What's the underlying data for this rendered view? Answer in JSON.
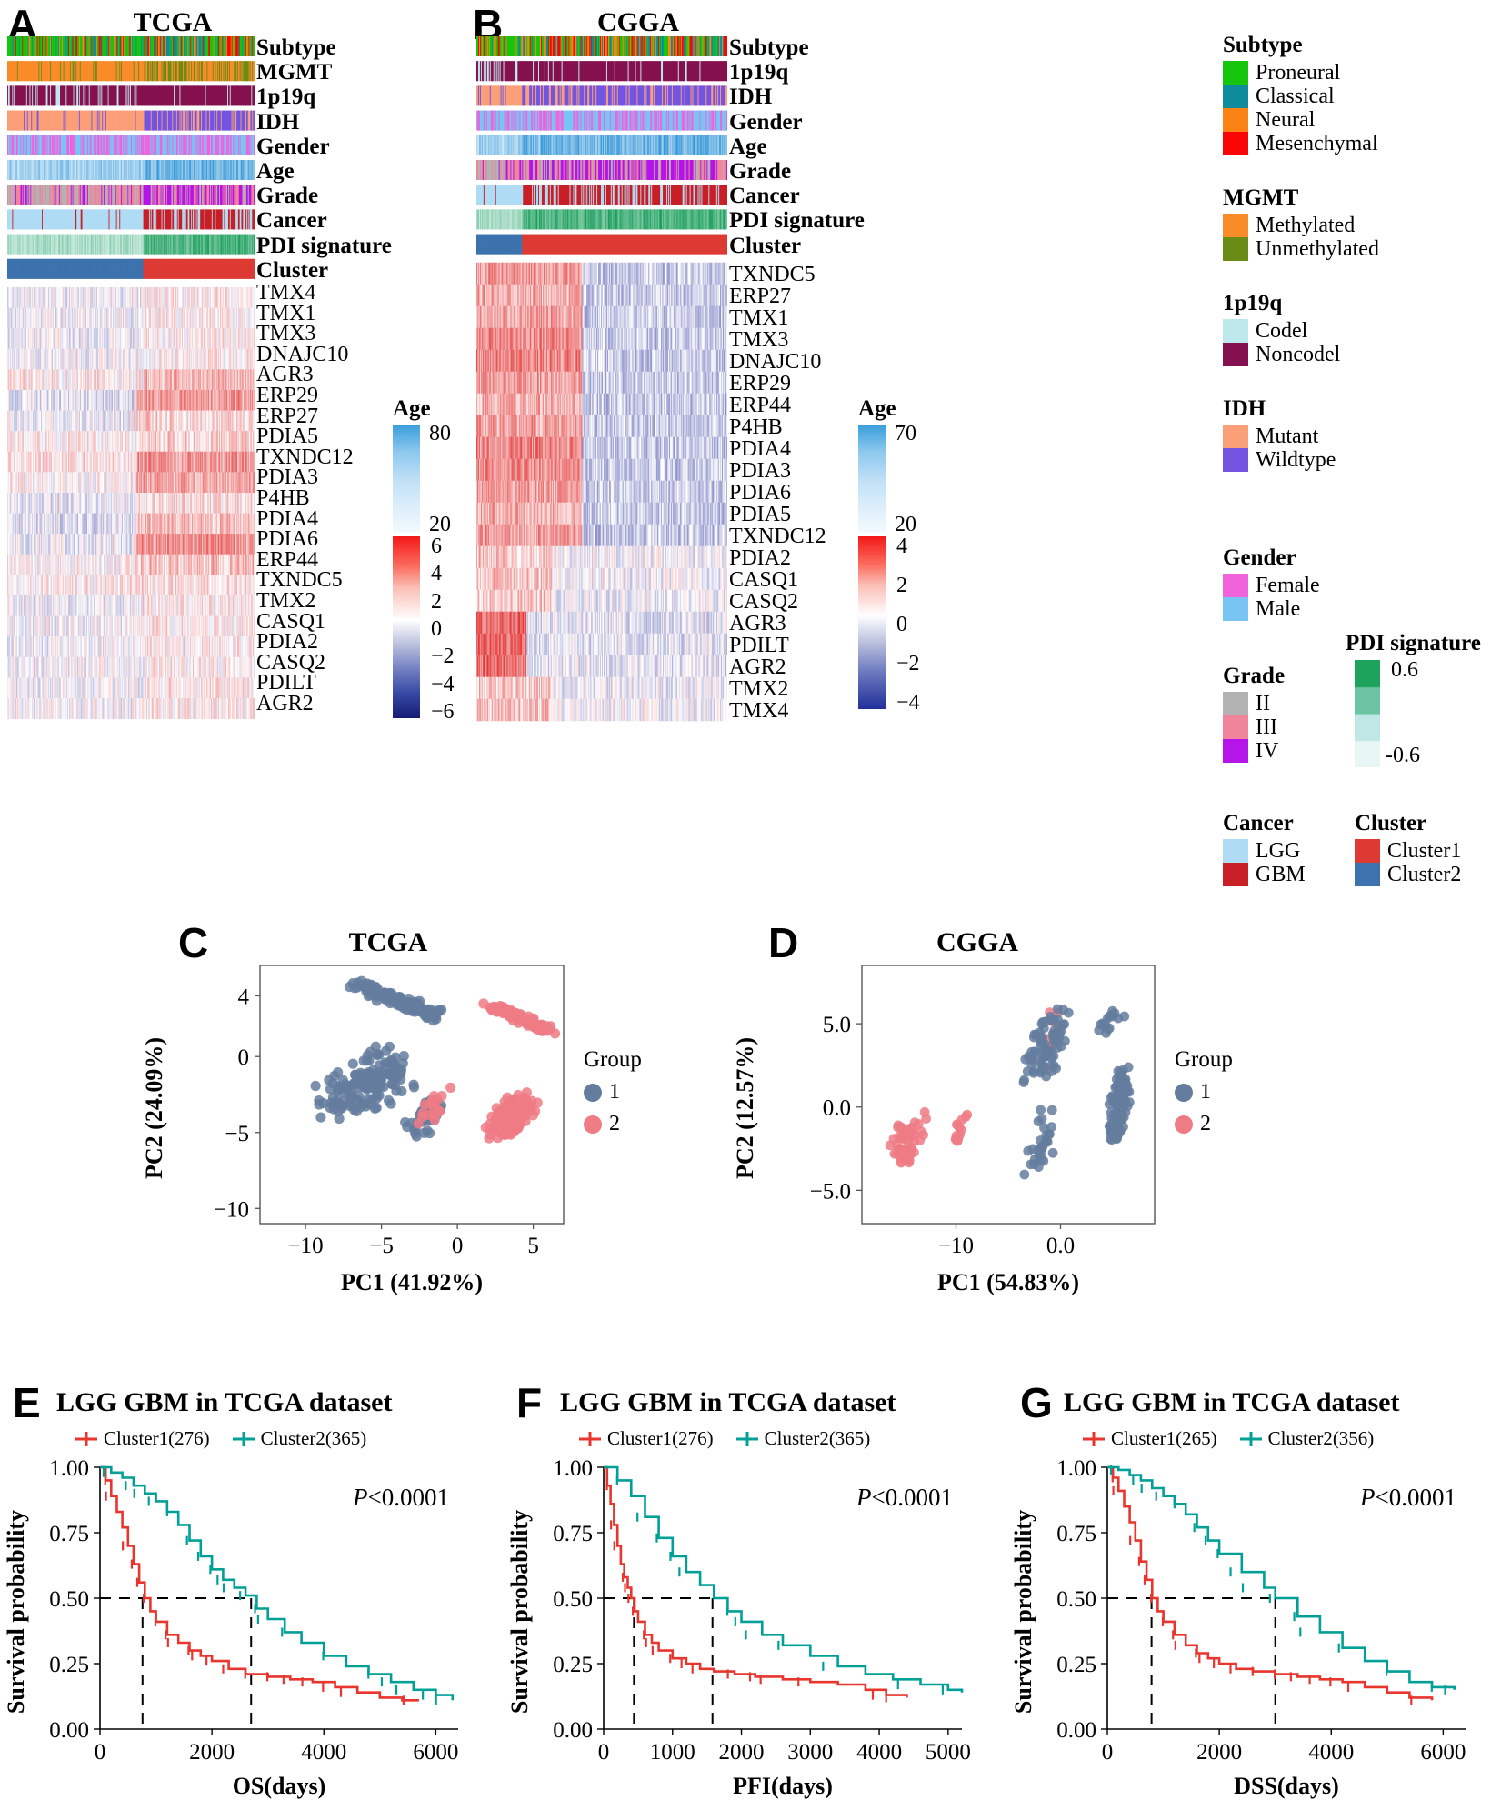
{
  "panels": {
    "A": {
      "letter": "A",
      "title": "TCGA"
    },
    "B": {
      "letter": "B",
      "title": "CGGA"
    },
    "C": {
      "letter": "C",
      "title": "TCGA"
    },
    "D": {
      "letter": "D",
      "title": "CGGA"
    },
    "E": {
      "letter": "E",
      "title": "LGG GBM in TCGA dataset"
    },
    "F": {
      "letter": "F",
      "title": "LGG GBM in TCGA dataset"
    },
    "G": {
      "letter": "G",
      "title": "LGG GBM in TCGA dataset"
    }
  },
  "heatmap_tcga": {
    "annotations": [
      "Subtype",
      "MGMT",
      "1p19q",
      "IDH",
      "Gender",
      "Age",
      "Grade",
      "Cancer",
      "PDI signature",
      "Cluster"
    ],
    "genes": [
      "TMX4",
      "TMX1",
      "TMX3",
      "DNAJC10",
      "AGR3",
      "ERP29",
      "ERP27",
      "PDIA5",
      "TXNDC12",
      "PDIA3",
      "P4HB",
      "PDIA4",
      "PDIA6",
      "ERP44",
      "TXNDC5",
      "TMX2",
      "CASQ1",
      "PDIA2",
      "CASQ2",
      "PDILT",
      "AGR2"
    ],
    "age_legend": {
      "title": "Age",
      "max": "80",
      "min": "20"
    },
    "expr_legend": {
      "ticks": [
        "6",
        "4",
        "2",
        "0",
        "-2",
        "-4",
        "-6"
      ]
    }
  },
  "heatmap_cgga": {
    "annotations": [
      "Subtype",
      "1p19q",
      "IDH",
      "Gender",
      "Age",
      "Grade",
      "Cancer",
      "PDI signature",
      "Cluster"
    ],
    "genes": [
      "TXNDC5",
      "ERP27",
      "TMX1",
      "TMX3",
      "DNAJC10",
      "ERP29",
      "ERP44",
      "P4HB",
      "PDIA4",
      "PDIA3",
      "PDIA6",
      "PDIA5",
      "TXNDC12",
      "PDIA2",
      "CASQ1",
      "CASQ2",
      "AGR3",
      "PDILT",
      "AGR2",
      "TMX2",
      "TMX4"
    ],
    "age_legend": {
      "title": "Age",
      "max": "70",
      "min": "20"
    },
    "expr_legend": {
      "ticks": [
        "4",
        "2",
        "0",
        "-2",
        "-4"
      ]
    }
  },
  "legend": {
    "subtype": {
      "title": "Subtype",
      "items": [
        {
          "label": "Proneural",
          "color": "#16C60C"
        },
        {
          "label": "Classical",
          "color": "#0E8C9B"
        },
        {
          "label": "Neural",
          "color": "#FB8315"
        },
        {
          "label": "Mesenchymal",
          "color": "#FB0606"
        }
      ]
    },
    "mgmt": {
      "title": "MGMT",
      "items": [
        {
          "label": "Methylated",
          "color": "#F98C28"
        },
        {
          "label": "Unmethylated",
          "color": "#6B8B17"
        }
      ]
    },
    "p1p19q": {
      "title": "1p19q",
      "items": [
        {
          "label": "Codel",
          "color": "#BEE9EC"
        },
        {
          "label": "Noncodel",
          "color": "#85104F"
        }
      ]
    },
    "idh": {
      "title": "IDH",
      "items": [
        {
          "label": "Mutant",
          "color": "#FB9F78"
        },
        {
          "label": "Wildtype",
          "color": "#7355E2"
        }
      ]
    },
    "gender": {
      "title": "Gender",
      "items": [
        {
          "label": "Female",
          "color": "#F163DC"
        },
        {
          "label": "Male",
          "color": "#78C5F3"
        }
      ]
    },
    "grade": {
      "title": "Grade",
      "items": [
        {
          "label": "II",
          "color": "#B3B3B3"
        },
        {
          "label": "III",
          "color": "#F0849A"
        },
        {
          "label": "IV",
          "color": "#B515E8"
        }
      ]
    },
    "cancer": {
      "title": "Cancer",
      "items": [
        {
          "label": "LGG",
          "color": "#AFDCF4"
        },
        {
          "label": "GBM",
          "color": "#C91F27"
        }
      ]
    },
    "pdi": {
      "title": "PDI signature",
      "max": "0.6",
      "min": "-0.6"
    },
    "cluster": {
      "title": "Cluster",
      "items": [
        {
          "label": "Cluster1",
          "color": "#DC3A32"
        },
        {
          "label": "Cluster2",
          "color": "#3C72AD"
        }
      ]
    }
  },
  "pca": {
    "group_title": "Group",
    "groups": [
      {
        "label": "1",
        "color": "#647D9E"
      },
      {
        "label": "2",
        "color": "#EF7B85"
      }
    ],
    "tcga": {
      "xlabel": "PC1 (41.92%)",
      "ylabel": "PC2 (24.09%)",
      "xticks": [
        "-10",
        "-5",
        "0",
        "5"
      ],
      "yticks": [
        "-10",
        "-5",
        "0",
        "4"
      ]
    },
    "cgga": {
      "xlabel": "PC1 (54.83%)",
      "ylabel": "PC2 (12.57%)",
      "xticks": [
        "-10",
        "0.0"
      ],
      "yticks": [
        "-5.0",
        "0.0",
        "5.0"
      ]
    }
  },
  "chart_data": [
    {
      "type": "scatter",
      "title": "TCGA",
      "xlabel": "PC1 (41.92%)",
      "ylabel": "PC2 (24.09%)",
      "xlim": [
        -13,
        7
      ],
      "ylim": [
        -11,
        6
      ],
      "xticks": [
        -10,
        -5,
        0,
        5
      ],
      "yticks": [
        -10,
        -5,
        0,
        4
      ],
      "legend": "Group",
      "legend_position": "right",
      "series": [
        {
          "name": "1",
          "color": "#647D9E",
          "n": 365
        },
        {
          "name": "2",
          "color": "#EF7B85",
          "n": 276
        }
      ]
    },
    {
      "type": "scatter",
      "title": "CGGA",
      "xlabel": "PC1 (54.83%)",
      "ylabel": "PC2 (12.57%)",
      "xlim": [
        -19,
        9
      ],
      "ylim": [
        -7,
        8.5
      ],
      "xticks": [
        -10,
        0
      ],
      "yticks": [
        -5,
        0,
        5
      ],
      "legend": "Group",
      "legend_position": "right",
      "series": [
        {
          "name": "1",
          "color": "#647D9E"
        },
        {
          "name": "2",
          "color": "#EF7B85"
        }
      ]
    },
    {
      "type": "line",
      "title": "LGG GBM in TCGA dataset",
      "xlabel": "OS(days)",
      "ylabel": "Survival probability",
      "xlim": [
        0,
        6400
      ],
      "ylim": [
        0,
        1
      ],
      "xticks": [
        0,
        2000,
        4000,
        6000
      ],
      "yticks": [
        0.0,
        0.25,
        0.5,
        0.75,
        1.0
      ],
      "annotation": "P<0.0001",
      "median_lines": [
        760,
        2700
      ],
      "series": [
        {
          "name": "Cluster1(276)",
          "color": "#E8352E",
          "x": [
            0,
            100,
            200,
            300,
            400,
            500,
            600,
            700,
            800,
            900,
            1000,
            1200,
            1400,
            1600,
            1800,
            2000,
            2300,
            2600,
            3000,
            3400,
            3800,
            4200,
            4600,
            5000,
            5400,
            5700
          ],
          "y": [
            1.0,
            0.95,
            0.89,
            0.83,
            0.77,
            0.7,
            0.63,
            0.56,
            0.5,
            0.45,
            0.41,
            0.36,
            0.33,
            0.3,
            0.28,
            0.26,
            0.23,
            0.21,
            0.2,
            0.19,
            0.18,
            0.16,
            0.14,
            0.12,
            0.11,
            0.11
          ]
        },
        {
          "name": "Cluster2(365)",
          "color": "#00A097",
          "x": [
            0,
            200,
            400,
            600,
            800,
            1000,
            1200,
            1400,
            1600,
            1800,
            2000,
            2200,
            2400,
            2600,
            2800,
            3000,
            3300,
            3600,
            4000,
            4400,
            4800,
            5200,
            5600,
            6000,
            6300
          ],
          "y": [
            1.0,
            0.98,
            0.96,
            0.93,
            0.9,
            0.87,
            0.83,
            0.78,
            0.72,
            0.66,
            0.61,
            0.57,
            0.54,
            0.51,
            0.46,
            0.42,
            0.37,
            0.33,
            0.28,
            0.24,
            0.21,
            0.18,
            0.15,
            0.13,
            0.11
          ]
        }
      ]
    },
    {
      "type": "line",
      "title": "LGG GBM in TCGA dataset",
      "xlabel": "PFI(days)",
      "ylabel": "Survival probability",
      "xlim": [
        0,
        5200
      ],
      "ylim": [
        0,
        1
      ],
      "xticks": [
        0,
        1000,
        2000,
        3000,
        4000,
        5000
      ],
      "yticks": [
        0.0,
        0.25,
        0.5,
        0.75,
        1.0
      ],
      "annotation": "P<0.0001",
      "median_lines": [
        440,
        1580
      ],
      "series": [
        {
          "name": "Cluster1(276)",
          "color": "#E8352E",
          "x": [
            0,
            50,
            100,
            150,
            200,
            250,
            300,
            350,
            400,
            450,
            500,
            600,
            700,
            800,
            1000,
            1200,
            1400,
            1600,
            1900,
            2200,
            2600,
            3000,
            3400,
            3800,
            4100,
            4400
          ],
          "y": [
            1.0,
            0.93,
            0.86,
            0.78,
            0.7,
            0.63,
            0.58,
            0.54,
            0.5,
            0.45,
            0.41,
            0.36,
            0.33,
            0.3,
            0.27,
            0.25,
            0.23,
            0.22,
            0.21,
            0.2,
            0.19,
            0.18,
            0.17,
            0.15,
            0.13,
            0.12
          ]
        },
        {
          "name": "Cluster2(365)",
          "color": "#00A097",
          "x": [
            0,
            200,
            400,
            600,
            800,
            1000,
            1200,
            1400,
            1600,
            1800,
            2000,
            2300,
            2600,
            3000,
            3400,
            3800,
            4200,
            4600,
            5000,
            5200
          ],
          "y": [
            1.0,
            0.95,
            0.89,
            0.81,
            0.73,
            0.66,
            0.6,
            0.55,
            0.5,
            0.45,
            0.41,
            0.36,
            0.32,
            0.28,
            0.24,
            0.21,
            0.19,
            0.17,
            0.15,
            0.14
          ]
        }
      ]
    },
    {
      "type": "line",
      "title": "LGG GBM in TCGA dataset",
      "xlabel": "DSS(days)",
      "ylabel": "Survival probability",
      "xlim": [
        0,
        6400
      ],
      "ylim": [
        0,
        1
      ],
      "xticks": [
        0,
        2000,
        4000,
        6000
      ],
      "yticks": [
        0.0,
        0.25,
        0.5,
        0.75,
        1.0
      ],
      "annotation": "P<0.0001",
      "median_lines": [
        790,
        3000
      ],
      "series": [
        {
          "name": "Cluster1(265)",
          "color": "#E8352E",
          "x": [
            0,
            100,
            200,
            300,
            400,
            500,
            600,
            700,
            800,
            900,
            1000,
            1200,
            1400,
            1600,
            1800,
            2000,
            2300,
            2600,
            3000,
            3400,
            3800,
            4200,
            4600,
            5000,
            5400,
            5800
          ],
          "y": [
            1.0,
            0.96,
            0.91,
            0.85,
            0.79,
            0.72,
            0.64,
            0.57,
            0.5,
            0.45,
            0.41,
            0.36,
            0.32,
            0.29,
            0.27,
            0.25,
            0.23,
            0.22,
            0.21,
            0.2,
            0.19,
            0.18,
            0.16,
            0.14,
            0.12,
            0.11
          ]
        },
        {
          "name": "Cluster2(356)",
          "color": "#00A097",
          "x": [
            0,
            200,
            400,
            600,
            800,
            1000,
            1200,
            1400,
            1600,
            1800,
            2000,
            2400,
            2800,
            3000,
            3400,
            3800,
            4200,
            4600,
            5000,
            5400,
            5800,
            6200
          ],
          "y": [
            1.0,
            0.99,
            0.97,
            0.95,
            0.92,
            0.89,
            0.86,
            0.82,
            0.77,
            0.72,
            0.67,
            0.6,
            0.54,
            0.5,
            0.43,
            0.37,
            0.31,
            0.26,
            0.22,
            0.18,
            0.16,
            0.15
          ]
        }
      ]
    }
  ],
  "km": {
    "legend_e": [
      "Cluster1(276)",
      "Cluster2(365)"
    ],
    "legend_f": [
      "Cluster1(276)",
      "Cluster2(365)"
    ],
    "legend_g": [
      "Cluster1(265)",
      "Cluster2(356)"
    ],
    "pvalue": "P",
    "pvalue_rest": "<0.0001",
    "ylabel": "Survival probability",
    "yticks": [
      "1.00",
      "0.75",
      "0.50",
      "0.25",
      "0.00"
    ],
    "xlabel_e": "OS(days)",
    "xlabel_f": "PFI(days)",
    "xlabel_g": "DSS(days)",
    "xticks_e": [
      "0",
      "2000",
      "4000",
      "6000"
    ],
    "xticks_f": [
      "0",
      "1000",
      "2000",
      "3000",
      "4000",
      "5000"
    ],
    "xticks_g": [
      "0",
      "2000",
      "4000",
      "6000"
    ],
    "colors": {
      "cluster1": "#E8352E",
      "cluster2": "#00A097"
    }
  }
}
